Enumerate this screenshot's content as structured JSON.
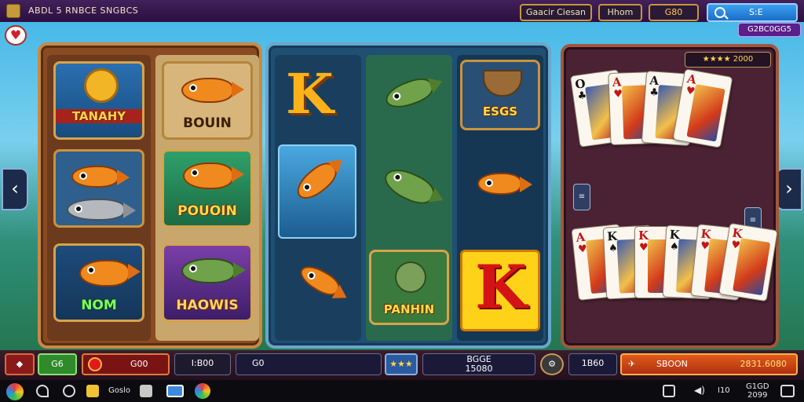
{
  "app": {
    "title": "ABDL 5 RNBCE SNGBCS"
  },
  "topbar": {
    "btn_classic": "Gaacir Ciesan",
    "btn_home": "Hhom",
    "btn_balance": "G80",
    "search_label": "S:E",
    "coins": "G2BC0GG5"
  },
  "heart_icon": "♥",
  "reels": {
    "left": {
      "tiles": [
        "TANAHY",
        "BOUIN",
        "",
        "POUOIN",
        "NOM",
        "HAOWIS"
      ]
    },
    "middle": {
      "k_symbol": "K",
      "tiles": [
        "",
        "",
        "ESGS",
        "",
        "",
        "",
        "",
        "PANHIN",
        "K"
      ]
    }
  },
  "cards": {
    "rating": "★★★★ 2000",
    "top": [
      {
        "rank": "O",
        "suit": "♣",
        "color": "black"
      },
      {
        "rank": "A",
        "suit": "♥",
        "color": "red"
      },
      {
        "rank": "A",
        "suit": "♣",
        "color": "black"
      },
      {
        "rank": "A",
        "suit": "♥",
        "color": "red"
      }
    ],
    "bottom": [
      {
        "rank": "A",
        "suit": "♥",
        "color": "red"
      },
      {
        "rank": "K",
        "suit": "♠",
        "color": "black"
      },
      {
        "rank": "K",
        "suit": "♥",
        "color": "red"
      },
      {
        "rank": "K",
        "suit": "♠",
        "color": "black"
      },
      {
        "rank": "K",
        "suit": "♥",
        "color": "red"
      },
      {
        "rank": "K",
        "suit": "♥",
        "color": "red"
      }
    ]
  },
  "controls": {
    "bet_value": "G6",
    "stake": "G00",
    "line_label": "I:B00",
    "field_value": "G0",
    "stars": "★★★",
    "total_label": "BGGE",
    "total_value": "15080",
    "win_label": "1B60",
    "spin_label": "SBOON",
    "spin_value": "2831.6080"
  },
  "taskbar": {
    "app1": "Goslo",
    "status_a": "I10",
    "clock_time": "G1GD",
    "clock_date": "2099"
  }
}
